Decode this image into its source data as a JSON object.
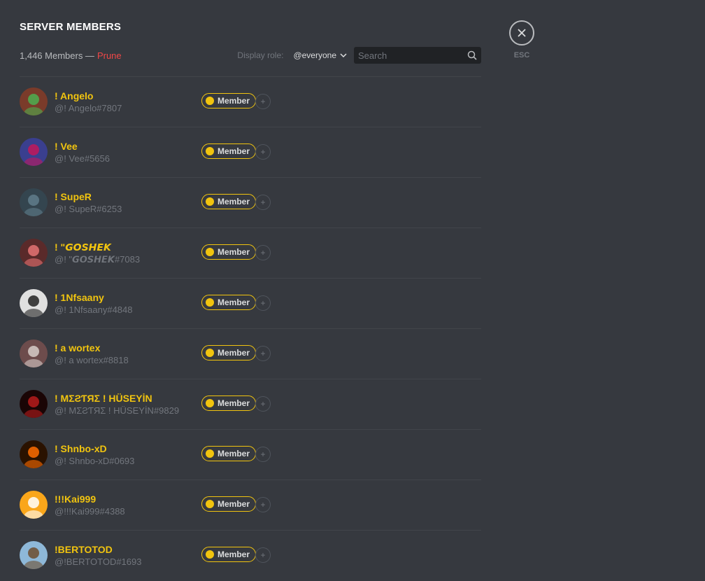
{
  "header": {
    "title": "SERVER MEMBERS",
    "count_text": "1,446 Members —",
    "prune_label": "Prune",
    "display_role_label": "Display role:",
    "display_role_value": "@everyone",
    "search_placeholder": "Search"
  },
  "close": {
    "icon": "close-icon",
    "esc_label": "ESC"
  },
  "role_label": "Member",
  "colors": {
    "background": "#36393f",
    "role_color": "#f1c40f",
    "prune": "#f04747",
    "search_bg": "#202225"
  },
  "members": [
    {
      "name": "! Angelo",
      "tag": "@! Angelo#7807",
      "avatar_color": "#7a3b2a",
      "avatar_accent": "#4caf50"
    },
    {
      "name": "! Vee",
      "tag": "@! Vee#5656",
      "avatar_color": "#3a3f8f",
      "avatar_accent": "#c2185b"
    },
    {
      "name": "! SupeR",
      "tag": "@! SupeR#6253",
      "avatar_color": "#34454f",
      "avatar_accent": "#607d8b"
    },
    {
      "name": "! \"𝙂𝙊𝙎𝙃𝙀𝙆",
      "tag": "@! \"𝙂𝙊𝙎𝙃𝙀𝙆#7083",
      "avatar_color": "#5a2a2a",
      "avatar_accent": "#e57373"
    },
    {
      "name": "! 1Nfsaany",
      "tag": "@! 1Nfsaany#4848",
      "avatar_color": "#e0e0e0",
      "avatar_accent": "#212121"
    },
    {
      "name": "! a wortex",
      "tag": "@! a wortex#8818",
      "avatar_color": "#6d4c4c",
      "avatar_accent": "#d7ccc8"
    },
    {
      "name": "! ΜΣƧƬЯΣ ! HÜSEYİN",
      "tag": "@! ΜΣƧƬЯΣ ! HÜSEYİN#9829",
      "avatar_color": "#1a0505",
      "avatar_accent": "#b71c1c"
    },
    {
      "name": "! Shnbo-xD",
      "tag": "@! Shnbo-xD#0693",
      "avatar_color": "#2a1200",
      "avatar_accent": "#ff6d00"
    },
    {
      "name": "!!!Kai999",
      "tag": "@!!!Kai999#4388",
      "avatar_color": "#faa61a",
      "avatar_accent": "#ffffff"
    },
    {
      "name": "!BERTOTOD",
      "tag": "@!BERTOTOD#1693",
      "avatar_color": "#8eb8d8",
      "avatar_accent": "#6d4c2f"
    }
  ]
}
